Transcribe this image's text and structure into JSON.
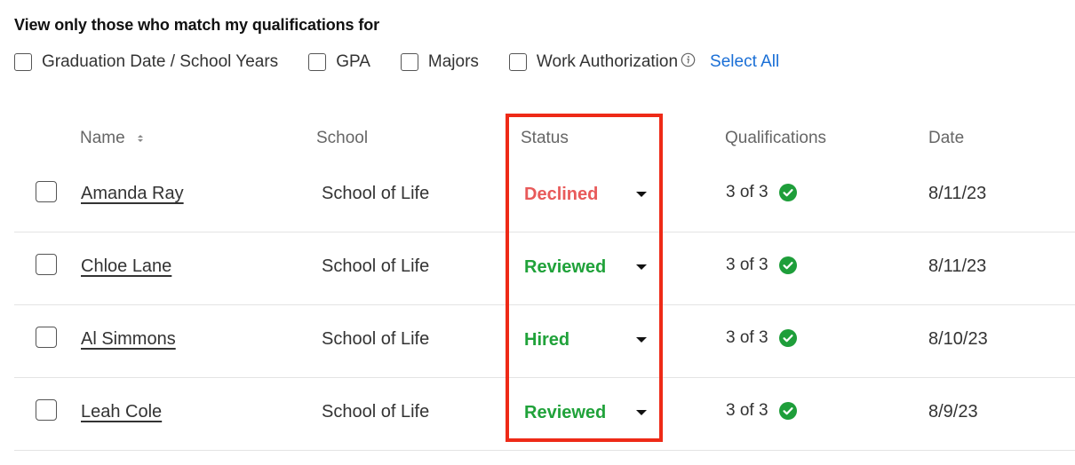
{
  "filters": {
    "title": "View only those who match my qualifications for",
    "items": [
      {
        "label": "Graduation Date / School Years",
        "checked": false
      },
      {
        "label": "GPA",
        "checked": false
      },
      {
        "label": "Majors",
        "checked": false
      },
      {
        "label": "Work Authorization",
        "checked": false
      }
    ],
    "select_all": "Select All"
  },
  "table": {
    "headers": {
      "name": "Name",
      "school": "School",
      "status": "Status",
      "qualifications": "Qualifications",
      "date": "Date"
    },
    "rows": [
      {
        "name": "Amanda Ray",
        "school": "School of Life",
        "status": "Declined",
        "status_color": "#e85a5a",
        "qualifications": "3 of 3",
        "date": "8/11/23"
      },
      {
        "name": "Chloe Lane",
        "school": "School of Life",
        "status": "Reviewed",
        "status_color": "#20a23a",
        "qualifications": "3 of 3",
        "date": "8/11/23"
      },
      {
        "name": "Al Simmons",
        "school": "School of Life",
        "status": "Hired",
        "status_color": "#20a23a",
        "qualifications": "3 of 3",
        "date": "8/10/23"
      },
      {
        "name": "Leah Cole",
        "school": "School of Life",
        "status": "Reviewed",
        "status_color": "#20a23a",
        "qualifications": "3 of 3",
        "date": "8/9/23"
      }
    ]
  },
  "colors": {
    "link": "#1a6fd6",
    "check": "#1e9e3a",
    "highlight": "#ee2a17"
  }
}
